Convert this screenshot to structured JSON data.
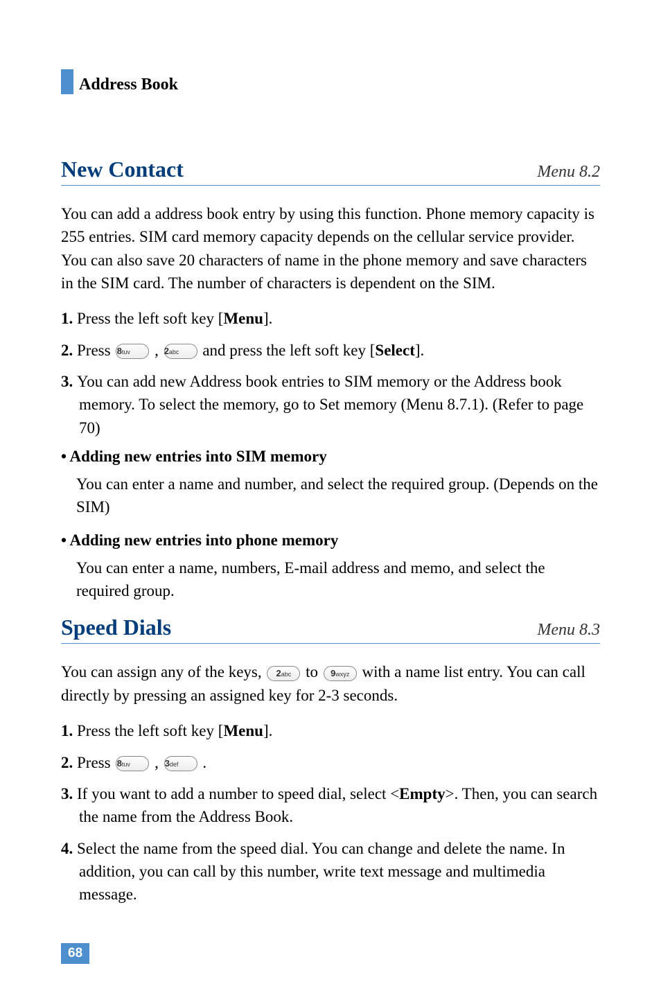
{
  "header": {
    "title": "Address Book"
  },
  "section1": {
    "title": "New Contact",
    "menu": "Menu 8.2",
    "intro": "You can add a address book entry by using this function. Phone memory capacity is 255 entries. SIM card memory capacity depends on the cellular service provider. You can also save 20 characters of name in the phone memory and save characters in the SIM card. The number of characters is dependent on the SIM.",
    "step1_pre": "Press the left soft key [",
    "step1_bold": "Menu",
    "step1_post": "].",
    "step2_pre": "Press ",
    "step2_mid": " , ",
    "step2_mid2": " and press the left soft key [",
    "step2_bold": "Select",
    "step2_post": "].",
    "step3": "You can add new Address book entries to SIM memory or the Address book memory. To select the memory, go to Set memory (Menu 8.7.1). (Refer to page 70)",
    "bullet1_heading": "• Adding new entries into SIM memory",
    "bullet1_body": "You can enter a name and number, and select the required group. (Depends on the SIM)",
    "bullet2_heading": "• Adding new entries into phone memory",
    "bullet2_body": "You can enter a name, numbers, E-mail address and memo, and select the required group."
  },
  "section2": {
    "title": "Speed Dials",
    "menu": "Menu 8.3",
    "intro_pre": "You can assign any of the keys, ",
    "intro_mid": " to ",
    "intro_post": " with a name list entry. You can call directly by pressing an assigned key for 2-3 seconds.",
    "step1_pre": "Press the left soft key [",
    "step1_bold": "Menu",
    "step1_post": "].",
    "step2_pre": "Press ",
    "step2_mid": " , ",
    "step2_post": " .",
    "step3_pre": "If you want to add a number to speed dial, select <",
    "step3_bold": "Empty",
    "step3_post": ">. Then, you can search the name from the Address Book.",
    "step4": "Select the name from the speed dial. You can change and delete the name. In addition, you can call by this number, write text message and multimedia message."
  },
  "keys": {
    "k2": "2abc",
    "k3": "3def",
    "k8": "8tuv",
    "k9": "9wxyz"
  },
  "page": "68"
}
